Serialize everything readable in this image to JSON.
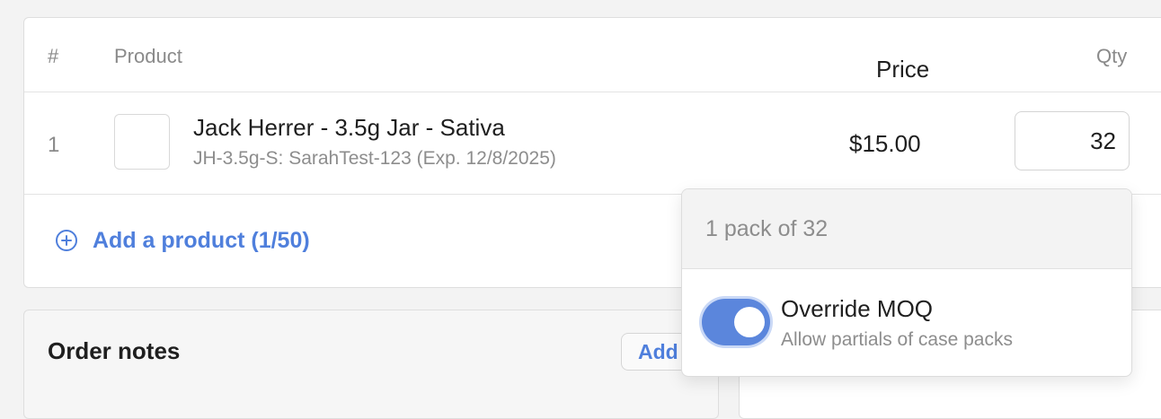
{
  "table": {
    "headers": {
      "number": "#",
      "product": "Product",
      "price": "Price",
      "qty": "Qty"
    },
    "rows": [
      {
        "number": "1",
        "name": "Jack Herrer - 3.5g Jar - Sativa",
        "subtitle": "JH-3.5g-S: SarahTest-123 (Exp. 12/8/2025)",
        "price": "$15.00",
        "qty": "32"
      }
    ],
    "add_product_label": "Add a product (1/50)"
  },
  "order_notes": {
    "title": "Order notes",
    "add_label": "Add"
  },
  "pack_popover": {
    "pack_text": "1 pack of 32",
    "override": {
      "label": "Override MOQ",
      "description": "Allow partials of case packs",
      "enabled": true
    }
  },
  "colors": {
    "accent": "#4f7fdc",
    "toggle_on": "#5b86dc"
  },
  "icons": {
    "add_product": "plus-circle-icon"
  }
}
